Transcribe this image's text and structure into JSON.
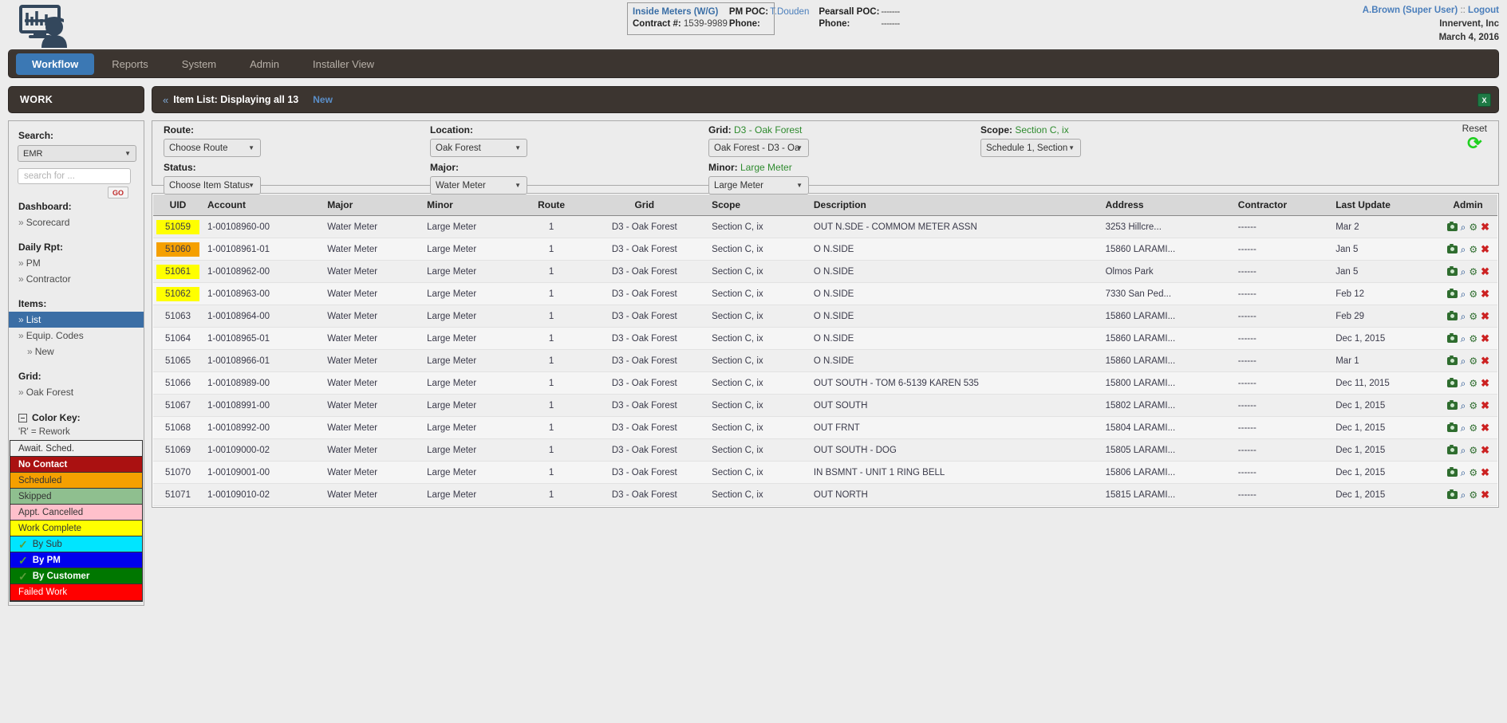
{
  "header": {
    "logo_name": "monitor-worker-logo",
    "contract_box": {
      "title": "Inside Meters (W/G)",
      "pm_poc_label": "PM POC:",
      "pm_poc_value": "T.Douden",
      "pearsall_poc_label": "Pearsall POC:",
      "pearsall_poc_value": "-------",
      "contract_label": "Contract #:",
      "contract_value": "1539-9989",
      "phone_label_1": "Phone:",
      "phone_value_1": "",
      "phone_label_2": "Phone:",
      "phone_value_2": "-------"
    },
    "user": "A.Brown (Super User)",
    "separator": "::",
    "logout": "Logout",
    "company": "Innervent, Inc",
    "date": "March 4, 2016"
  },
  "nav": {
    "items": [
      {
        "label": "Workflow",
        "active": true
      },
      {
        "label": "Reports",
        "active": false
      },
      {
        "label": "System",
        "active": false
      },
      {
        "label": "Admin",
        "active": false
      },
      {
        "label": "Installer View",
        "active": false
      }
    ]
  },
  "sidebar": {
    "work_title": "WORK",
    "search_label": "Search:",
    "search_type": "EMR",
    "search_placeholder": "search for ...",
    "go_label": "GO",
    "dashboard_label": "Dashboard:",
    "dashboard_items": [
      {
        "label": "Scorecard"
      }
    ],
    "daily_label": "Daily Rpt:",
    "daily_items": [
      {
        "label": "PM"
      },
      {
        "label": "Contractor"
      }
    ],
    "items_label": "Items:",
    "items_links": [
      {
        "label": "List",
        "active": true,
        "indent": false
      },
      {
        "label": "Equip. Codes",
        "active": false,
        "indent": false
      },
      {
        "label": "New",
        "active": false,
        "indent": true
      }
    ],
    "grid_label": "Grid:",
    "grid_items": [
      {
        "label": "Oak Forest"
      }
    ],
    "colorkey_label": "Color Key:",
    "colorkey_note": "'R' = Rework",
    "colorkey": [
      {
        "label": "Await. Sched.",
        "bg": "#efefef",
        "fg": "#333333",
        "check": false,
        "bold": false
      },
      {
        "label": "No Contact",
        "bg": "#aa1111",
        "fg": "#ffffff",
        "check": false,
        "bold": true
      },
      {
        "label": "Scheduled",
        "bg": "#f5a000",
        "fg": "#333333",
        "check": false,
        "bold": false
      },
      {
        "label": "Skipped",
        "bg": "#8fbf8f",
        "fg": "#333333",
        "check": false,
        "bold": false
      },
      {
        "label": "Appt. Cancelled",
        "bg": "#ffc0cb",
        "fg": "#333333",
        "check": false,
        "bold": false
      },
      {
        "label": "Work Complete",
        "bg": "#ffff00",
        "fg": "#333333",
        "check": false,
        "bold": false
      },
      {
        "label": "By Sub",
        "bg": "#00e5ff",
        "fg": "#333333",
        "check": true,
        "bold": false
      },
      {
        "label": "By PM",
        "bg": "#0000ee",
        "fg": "#ffffff",
        "check": true,
        "bold": true
      },
      {
        "label": "By Customer",
        "bg": "#007700",
        "fg": "#ffffff",
        "check": true,
        "bold": true
      },
      {
        "label": "Failed Work",
        "bg": "#ff0000",
        "fg": "#ffffff",
        "check": false,
        "bold": false
      }
    ]
  },
  "itemlist": {
    "chevron": "«",
    "title": "Item List: Displaying all 13",
    "new_label": "New",
    "excel_icon": "X"
  },
  "filters": {
    "route": {
      "label": "Route:",
      "value": "Choose Route"
    },
    "location": {
      "label": "Location:",
      "value": "Oak Forest"
    },
    "grid": {
      "label": "Grid:",
      "sub": "D3 - Oak Forest",
      "value": "Oak Forest - D3 - Oa"
    },
    "scope": {
      "label": "Scope:",
      "sub": "Section C, ix",
      "value": "Schedule 1, Section"
    },
    "status": {
      "label": "Status:",
      "value": "Choose Item Status"
    },
    "major": {
      "label": "Major:",
      "value": "Water Meter"
    },
    "minor": {
      "label": "Minor:",
      "sub": "Large Meter",
      "value": "Large Meter"
    },
    "reset": {
      "label": "Reset",
      "icon": "refresh-icon"
    }
  },
  "table": {
    "columns": [
      "UID",
      "Account",
      "Major",
      "Minor",
      "Route",
      "Grid",
      "Scope",
      "Description",
      "Address",
      "Contractor",
      "Last Update",
      "Admin"
    ],
    "rows": [
      {
        "uid": "51059",
        "uid_bg": "#ffff00",
        "account": "1-00108960-00",
        "major": "Water Meter",
        "minor": "Large Meter",
        "route": "1",
        "grid": "D3 - Oak Forest",
        "scope": "Section C, ix",
        "description": "OUT N.SDE - COMMOM METER ASSN",
        "address": "3253 Hillcre...",
        "contractor": "------",
        "last_update": "Mar 2"
      },
      {
        "uid": "51060",
        "uid_bg": "#f5a000",
        "account": "1-00108961-01",
        "major": "Water Meter",
        "minor": "Large Meter",
        "route": "1",
        "grid": "D3 - Oak Forest",
        "scope": "Section C, ix",
        "description": "O N.SIDE",
        "address": "15860 LARAMI...",
        "contractor": "------",
        "last_update": "Jan 5"
      },
      {
        "uid": "51061",
        "uid_bg": "#ffff00",
        "account": "1-00108962-00",
        "major": "Water Meter",
        "minor": "Large Meter",
        "route": "1",
        "grid": "D3 - Oak Forest",
        "scope": "Section C, ix",
        "description": "O N.SIDE",
        "address": "Olmos Park",
        "contractor": "------",
        "last_update": "Jan 5"
      },
      {
        "uid": "51062",
        "uid_bg": "#ffff00",
        "account": "1-00108963-00",
        "major": "Water Meter",
        "minor": "Large Meter",
        "route": "1",
        "grid": "D3 - Oak Forest",
        "scope": "Section C, ix",
        "description": "O N.SIDE",
        "address": "7330 San Ped...",
        "contractor": "------",
        "last_update": "Feb 12"
      },
      {
        "uid": "51063",
        "uid_bg": "",
        "account": "1-00108964-00",
        "major": "Water Meter",
        "minor": "Large Meter",
        "route": "1",
        "grid": "D3 - Oak Forest",
        "scope": "Section C, ix",
        "description": "O N.SIDE",
        "address": "15860 LARAMI...",
        "contractor": "------",
        "last_update": "Feb 29"
      },
      {
        "uid": "51064",
        "uid_bg": "",
        "account": "1-00108965-01",
        "major": "Water Meter",
        "minor": "Large Meter",
        "route": "1",
        "grid": "D3 - Oak Forest",
        "scope": "Section C, ix",
        "description": "O N.SIDE",
        "address": "15860 LARAMI...",
        "contractor": "------",
        "last_update": "Dec 1, 2015"
      },
      {
        "uid": "51065",
        "uid_bg": "",
        "account": "1-00108966-01",
        "major": "Water Meter",
        "minor": "Large Meter",
        "route": "1",
        "grid": "D3 - Oak Forest",
        "scope": "Section C, ix",
        "description": "O N.SIDE",
        "address": "15860 LARAMI...",
        "contractor": "------",
        "last_update": "Mar 1"
      },
      {
        "uid": "51066",
        "uid_bg": "",
        "account": "1-00108989-00",
        "major": "Water Meter",
        "minor": "Large Meter",
        "route": "1",
        "grid": "D3 - Oak Forest",
        "scope": "Section C, ix",
        "description": "OUT SOUTH - TOM 6-5139 KAREN 535",
        "address": "15800 LARAMI...",
        "contractor": "------",
        "last_update": "Dec 11, 2015"
      },
      {
        "uid": "51067",
        "uid_bg": "",
        "account": "1-00108991-00",
        "major": "Water Meter",
        "minor": "Large Meter",
        "route": "1",
        "grid": "D3 - Oak Forest",
        "scope": "Section C, ix",
        "description": "OUT SOUTH",
        "address": "15802 LARAMI...",
        "contractor": "------",
        "last_update": "Dec 1, 2015"
      },
      {
        "uid": "51068",
        "uid_bg": "",
        "account": "1-00108992-00",
        "major": "Water Meter",
        "minor": "Large Meter",
        "route": "1",
        "grid": "D3 - Oak Forest",
        "scope": "Section C, ix",
        "description": "OUT FRNT",
        "address": "15804 LARAMI...",
        "contractor": "------",
        "last_update": "Dec 1, 2015"
      },
      {
        "uid": "51069",
        "uid_bg": "",
        "account": "1-00109000-02",
        "major": "Water Meter",
        "minor": "Large Meter",
        "route": "1",
        "grid": "D3 - Oak Forest",
        "scope": "Section C, ix",
        "description": "OUT SOUTH - DOG",
        "address": "15805 LARAMI...",
        "contractor": "------",
        "last_update": "Dec 1, 2015"
      },
      {
        "uid": "51070",
        "uid_bg": "",
        "account": "1-00109001-00",
        "major": "Water Meter",
        "minor": "Large Meter",
        "route": "1",
        "grid": "D3 - Oak Forest",
        "scope": "Section C, ix",
        "description": "IN BSMNT - UNIT 1 RING BELL",
        "address": "15806 LARAMI...",
        "contractor": "------",
        "last_update": "Dec 1, 2015"
      },
      {
        "uid": "51071",
        "uid_bg": "",
        "account": "1-00109010-02",
        "major": "Water Meter",
        "minor": "Large Meter",
        "route": "1",
        "grid": "D3 - Oak Forest",
        "scope": "Section C, ix",
        "description": "OUT NORTH",
        "address": "15815 LARAMI...",
        "contractor": "------",
        "last_update": "Dec 1, 2015"
      }
    ],
    "admin_icons": [
      "camera-icon",
      "magnifier-icon",
      "gear-icon",
      "delete-x-icon"
    ]
  }
}
